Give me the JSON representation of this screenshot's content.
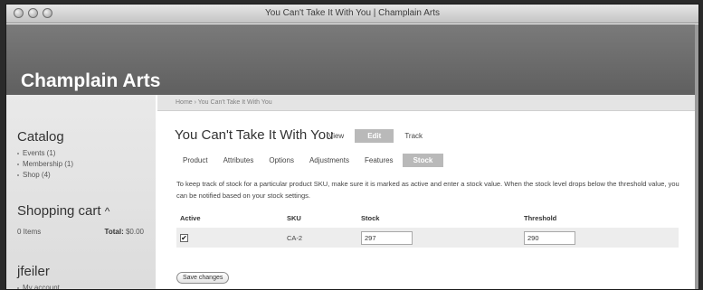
{
  "window": {
    "title": "You Can't Take It With You | Champlain Arts"
  },
  "site": {
    "name": "Champlain Arts"
  },
  "sidebar": {
    "catalog": {
      "heading": "Catalog",
      "items": [
        {
          "label": "Events (1)"
        },
        {
          "label": "Membership (1)"
        },
        {
          "label": "Shop (4)"
        }
      ]
    },
    "cart": {
      "heading": "Shopping cart",
      "toggle": "^",
      "items_text": "0 Items",
      "total_label": "Total:",
      "total_value": "$0.00"
    },
    "user": {
      "heading": "jfeiler",
      "items": [
        {
          "label": "My account"
        }
      ]
    }
  },
  "breadcrumb": {
    "text": "Home › You Can't Take It With You"
  },
  "page": {
    "title": "You Can't Take It With You"
  },
  "primary_tabs": [
    {
      "label": "View",
      "active": false
    },
    {
      "label": "Edit",
      "active": true
    },
    {
      "label": "Track",
      "active": false
    }
  ],
  "secondary_tabs": [
    {
      "label": "Product",
      "active": false
    },
    {
      "label": "Attributes",
      "active": false
    },
    {
      "label": "Options",
      "active": false
    },
    {
      "label": "Adjustments",
      "active": false
    },
    {
      "label": "Features",
      "active": false
    },
    {
      "label": "Stock",
      "active": true
    }
  ],
  "help": {
    "text": "To keep track of stock for a particular product SKU, make sure it is marked as active and enter a stock value. When the stock level drops below the threshold value, you can be notified based on your stock settings."
  },
  "stock_table": {
    "headers": {
      "active": "Active",
      "sku": "SKU",
      "stock": "Stock",
      "threshold": "Threshold"
    },
    "rows": [
      {
        "active_mark": "✔",
        "sku": "CA-2",
        "stock": "297",
        "threshold": "290"
      }
    ]
  },
  "actions": {
    "save_label": "Save changes"
  }
}
